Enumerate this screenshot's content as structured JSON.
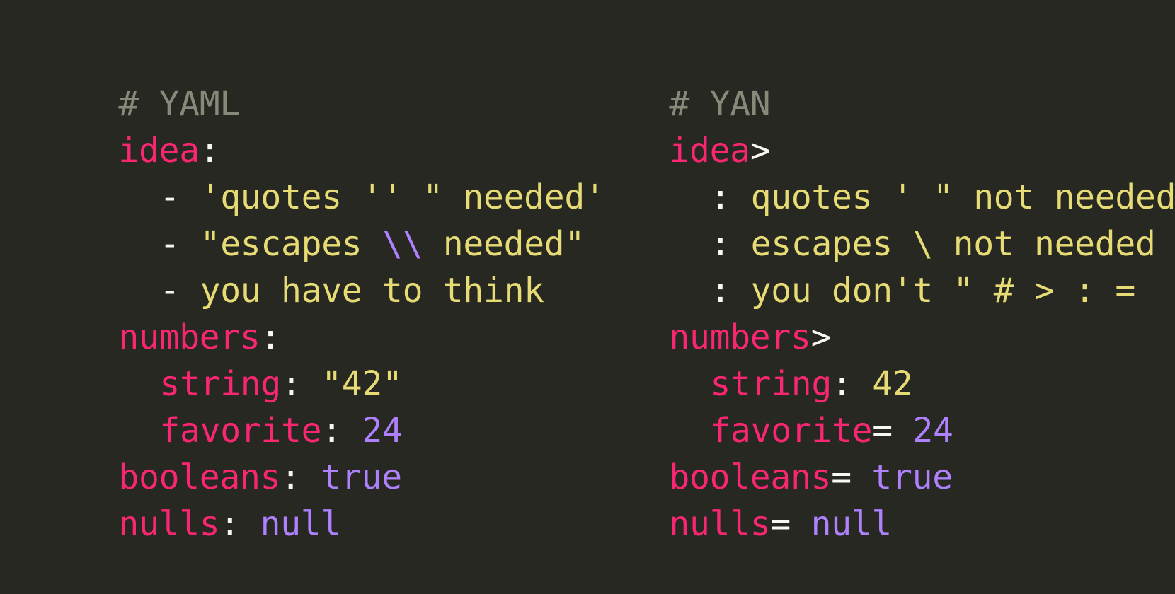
{
  "colors": {
    "background": "#272822",
    "comment": "#89897a",
    "key": "#f92672",
    "punctuation": "#f8f8f2",
    "string": "#e6db74",
    "constant": "#ae81ff"
  },
  "yaml": {
    "heading": "# YAML",
    "idea_key": "idea",
    "idea_sep": ":",
    "items": [
      {
        "marker": "- ",
        "text": "'quotes '' \" needed'"
      },
      {
        "marker": "- ",
        "text_before": "\"escapes ",
        "escape": "\\\\",
        "text_after": " needed\""
      },
      {
        "marker": "- ",
        "text": "you have to think"
      }
    ],
    "numbers_key": "numbers",
    "numbers_sep": ":",
    "string_key": "string",
    "string_sep": ": ",
    "string_value": "\"42\"",
    "favorite_key": "favorite",
    "favorite_sep": ": ",
    "favorite_value": "24",
    "booleans_key": "booleans",
    "booleans_sep": ": ",
    "booleans_value": "true",
    "nulls_key": "nulls",
    "nulls_sep": ": ",
    "nulls_value": "null"
  },
  "yan": {
    "heading": "# YAN",
    "idea_key": "idea",
    "idea_sep": ">",
    "items": [
      {
        "marker": ": ",
        "text": "quotes ' \" not needed"
      },
      {
        "marker": ": ",
        "text": "escapes \\ not needed"
      },
      {
        "marker": ": ",
        "text": "you don't \" # > : ="
      }
    ],
    "numbers_key": "numbers",
    "numbers_sep": ">",
    "string_key": "string",
    "string_sep": ": ",
    "string_value": "42",
    "favorite_key": "favorite",
    "favorite_sep": "= ",
    "favorite_value": "24",
    "booleans_key": "booleans",
    "booleans_sep": "= ",
    "booleans_value": "true",
    "nulls_key": "nulls",
    "nulls_sep": "= ",
    "nulls_value": "null"
  }
}
